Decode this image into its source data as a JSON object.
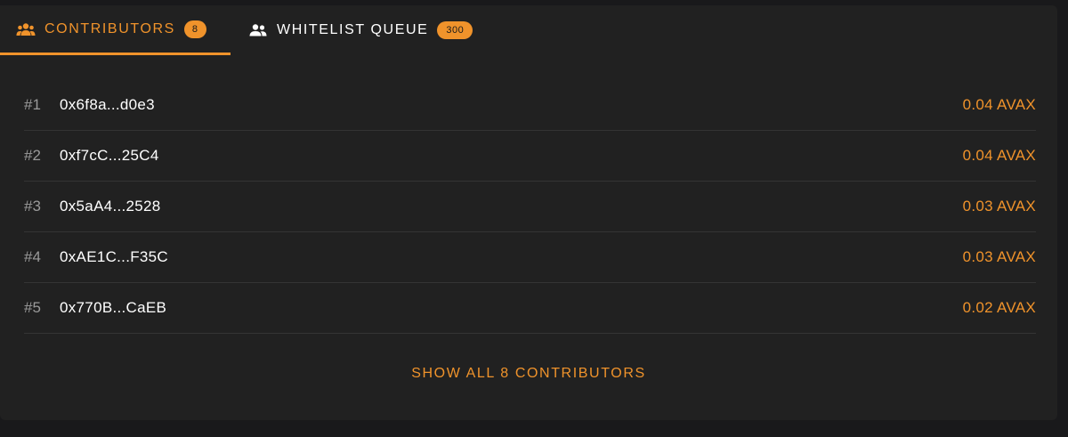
{
  "tabs": {
    "contributors": {
      "label": "CONTRIBUTORS",
      "count": "8",
      "icon": "group-icon"
    },
    "whitelist": {
      "label": "WHITELIST QUEUE",
      "count": "300",
      "icon": "people-icon"
    }
  },
  "contributors": [
    {
      "rank": "#1",
      "address": "0x6f8a...d0e3",
      "amount": "0.04 AVAX"
    },
    {
      "rank": "#2",
      "address": "0xf7cC...25C4",
      "amount": "0.04 AVAX"
    },
    {
      "rank": "#3",
      "address": "0x5aA4...2528",
      "amount": "0.03 AVAX"
    },
    {
      "rank": "#4",
      "address": "0xAE1C...F35C",
      "amount": "0.03 AVAX"
    },
    {
      "rank": "#5",
      "address": "0x770B...CaEB",
      "amount": "0.02 AVAX"
    }
  ],
  "show_all_label": "SHOW ALL 8 CONTRIBUTORS",
  "colors": {
    "accent": "#f0932b",
    "panel": "#212121",
    "background": "#19191b"
  }
}
